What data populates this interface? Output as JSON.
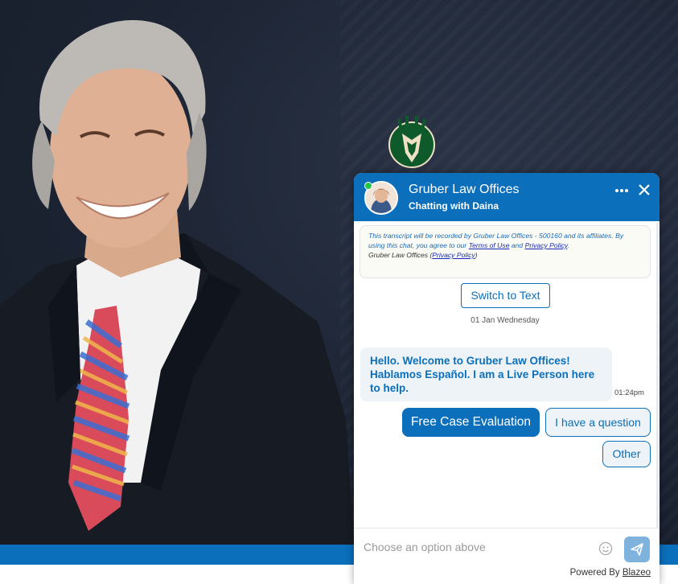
{
  "chat": {
    "title": "Gruber Law Offices",
    "subtitle": "Chatting with Daina",
    "more_icon": "more-dots-icon",
    "close_icon": "close-icon",
    "notice": {
      "text_prefix": "This transcript will be recorded by Gruber Law Offices - 500160 and its affiliates. By using this chat, you agree to our ",
      "terms_link": "Terms of Use",
      "and": " and ",
      "privacy_link": "Privacy Policy",
      "period": ".",
      "line2_prefix": "Gruber Law Offices (",
      "line2_link": "Privacy Policy",
      "line2_suffix": ")"
    },
    "switch_label": "Switch to Text",
    "date_label": "01 Jan Wednesday",
    "message": "Hello. Welcome to Gruber Law Offices! Hablamos Español. I am a Live Person here to help.",
    "message_time": "01:24pm",
    "options": {
      "free_case": "Free Case Evaluation",
      "question": "I have a question",
      "other": "Other"
    },
    "composer": {
      "placeholder": "Choose an option above",
      "emoji_icon": "smiley-icon",
      "send_icon": "send-icon"
    },
    "powered_prefix": "Powered By ",
    "powered_link": "Blazeo"
  },
  "colors": {
    "brand_blue": "#0b6fbb",
    "online_green": "#25c44a",
    "send_disabled": "#7fb3de"
  }
}
